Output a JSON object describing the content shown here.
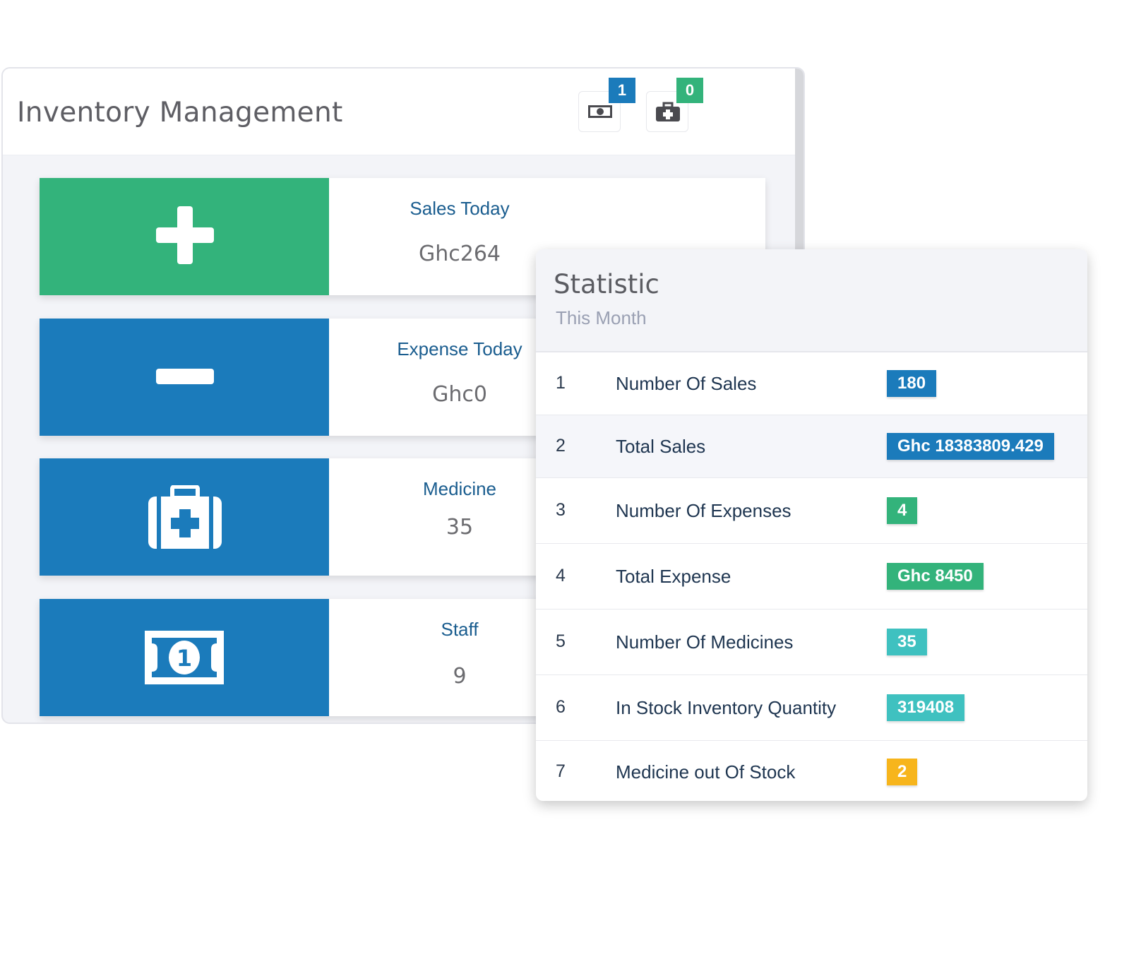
{
  "header": {
    "title": "Inventory Management",
    "notifications": [
      {
        "icon": "money-icon",
        "count": "1",
        "color": "#1b7bbb"
      },
      {
        "icon": "medkit-icon",
        "count": "0",
        "color": "#33b37b"
      }
    ]
  },
  "cards": [
    {
      "label": "Sales Today",
      "value": "Ghc264",
      "icon": "plus-icon",
      "color": "#33b37b"
    },
    {
      "label": "Expense Today",
      "value": "Ghc0",
      "icon": "minus-icon",
      "color": "#1b7bbb"
    },
    {
      "label": "Medicine",
      "value": "35",
      "icon": "medkit-icon",
      "color": "#1b7bbb"
    },
    {
      "label": "Staff",
      "value": "9",
      "icon": "money-icon",
      "color": "#1b7bbb"
    }
  ],
  "statistic": {
    "title": "Statistic",
    "subtitle": "This Month",
    "rows": [
      {
        "num": "1",
        "label": "Number Of Sales",
        "badge": "180",
        "color": "#1b7bbb"
      },
      {
        "num": "2",
        "label": "Total Sales",
        "badge": "Ghc 18383809.429",
        "color": "#1b7bbb"
      },
      {
        "num": "3",
        "label": "Number Of Expenses",
        "badge": "4",
        "color": "#33b37b"
      },
      {
        "num": "4",
        "label": "Total Expense",
        "badge": "Ghc 8450",
        "color": "#33b37b"
      },
      {
        "num": "5",
        "label": "Number Of Medicines",
        "badge": "35",
        "color": "#3fc1c0"
      },
      {
        "num": "6",
        "label": "In Stock Inventory Quantity",
        "badge": "319408",
        "color": "#3fc1c0"
      },
      {
        "num": "7",
        "label": "Medicine out Of Stock",
        "badge": "2",
        "color": "#f7b51c"
      }
    ]
  }
}
